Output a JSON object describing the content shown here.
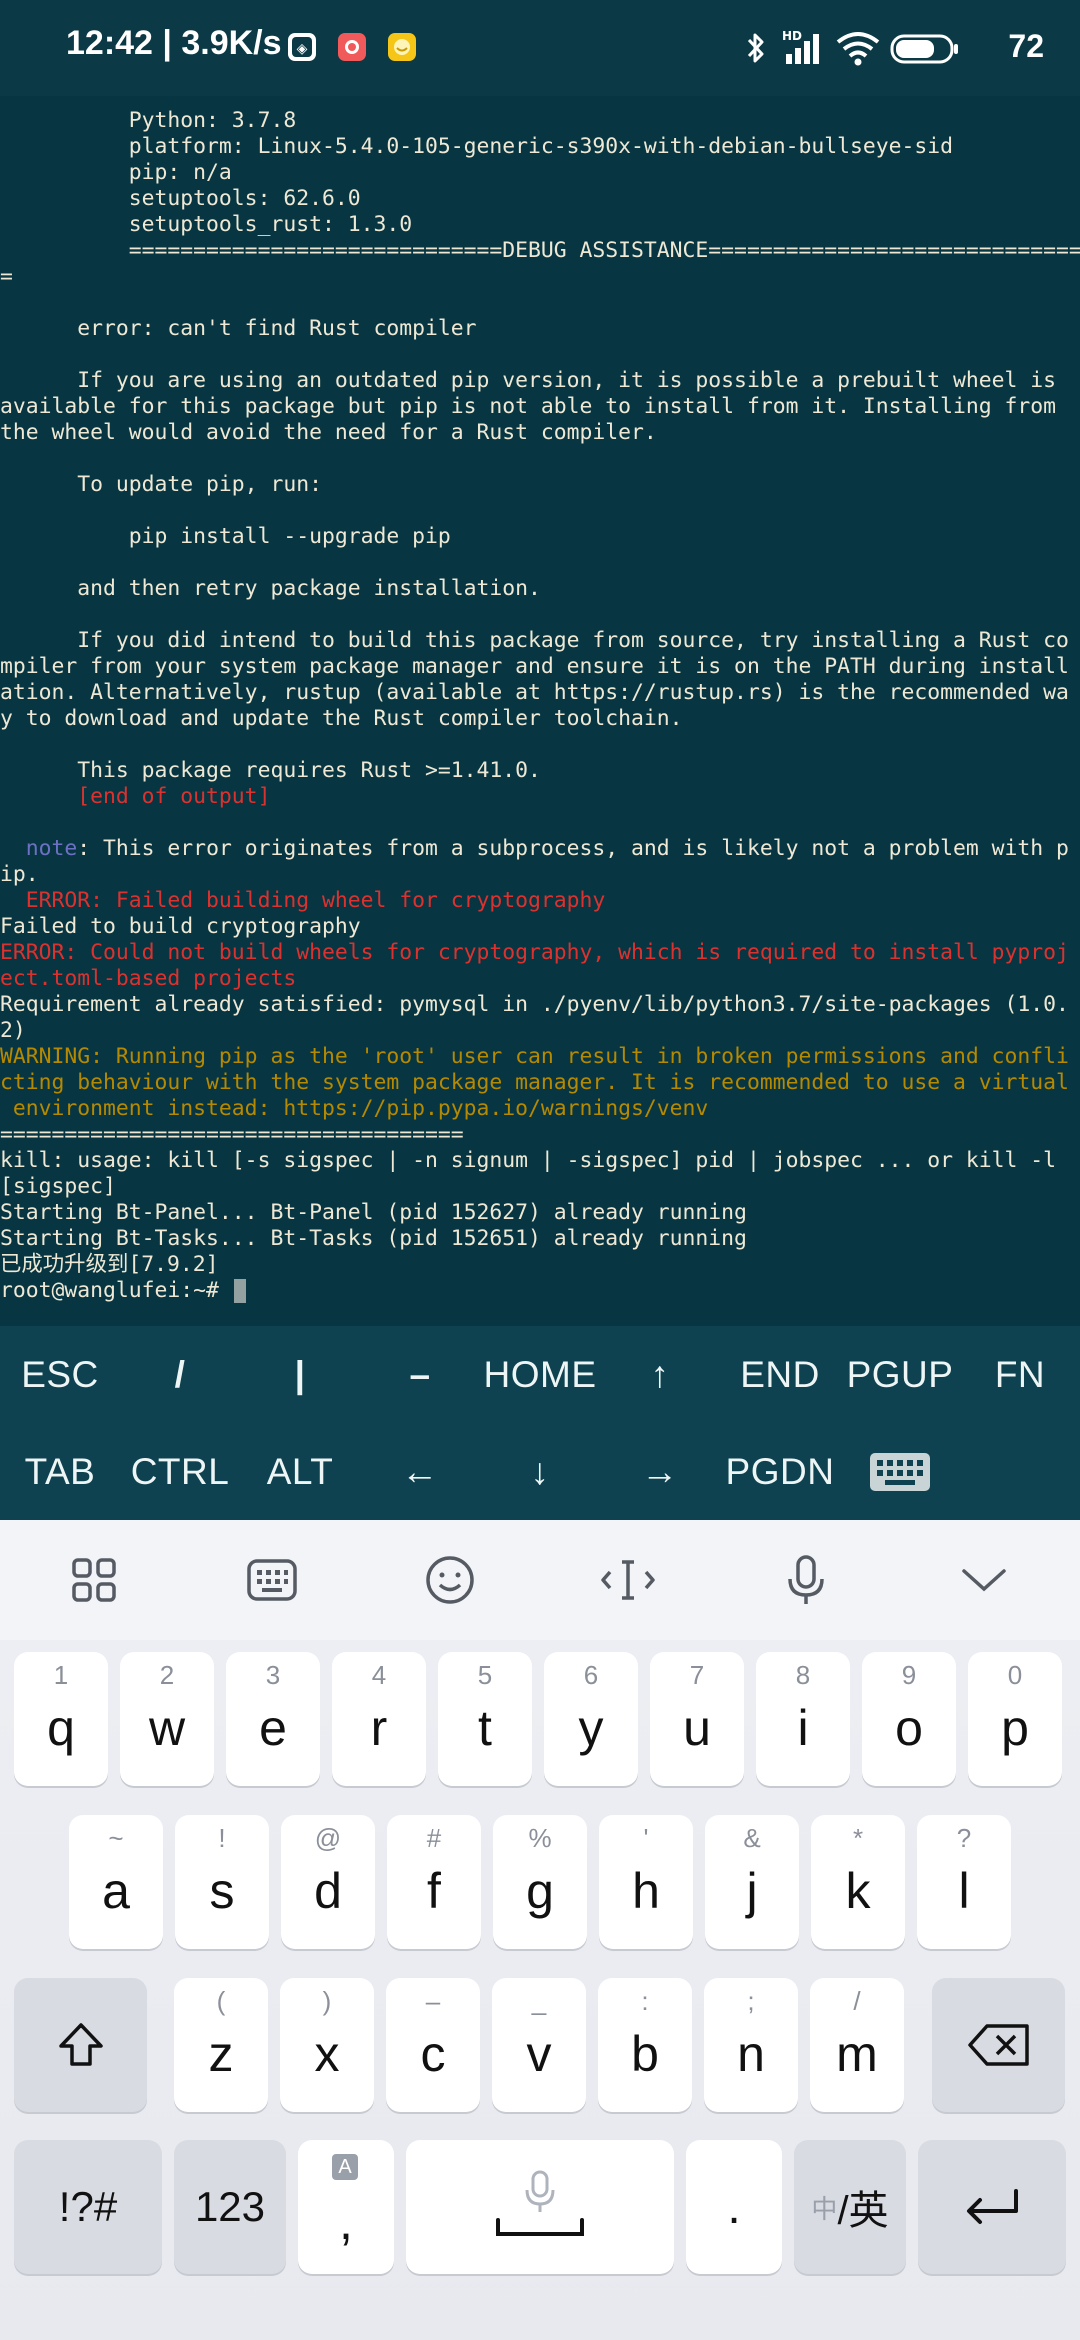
{
  "status_bar": {
    "time_speed": "12:42 | 3.9K/s",
    "battery": "72",
    "icons": [
      "bluetooth-icon",
      "hd-signal-icon",
      "wifi-icon",
      "battery-icon"
    ]
  },
  "terminal": {
    "lines": [
      {
        "text": "          Python: 3.7.8",
        "style": ""
      },
      {
        "text": "          platform: Linux-5.4.0-105-generic-s390x-with-debian-bullseye-sid",
        "style": ""
      },
      {
        "text": "          pip: n/a",
        "style": ""
      },
      {
        "text": "          setuptools: 62.6.0",
        "style": ""
      },
      {
        "text": "          setuptools_rust: 1.3.0",
        "style": ""
      },
      {
        "text": "          =============================DEBUG ASSISTANCE=============================",
        "style": ""
      },
      {
        "text": "=",
        "style": ""
      },
      {
        "text": "",
        "style": ""
      },
      {
        "text": "      error: can't find Rust compiler",
        "style": ""
      },
      {
        "text": "",
        "style": ""
      },
      {
        "text": "      If you are using an outdated pip version, it is possible a prebuilt wheel is",
        "style": ""
      },
      {
        "text": "available for this package but pip is not able to install from it. Installing from",
        "style": ""
      },
      {
        "text": "the wheel would avoid the need for a Rust compiler.",
        "style": ""
      },
      {
        "text": "",
        "style": ""
      },
      {
        "text": "      To update pip, run:",
        "style": ""
      },
      {
        "text": "",
        "style": ""
      },
      {
        "text": "          pip install --upgrade pip",
        "style": ""
      },
      {
        "text": "",
        "style": ""
      },
      {
        "text": "      and then retry package installation.",
        "style": ""
      },
      {
        "text": "",
        "style": ""
      },
      {
        "text": "      If you did intend to build this package from source, try installing a Rust co",
        "style": ""
      },
      {
        "text": "mpiler from your system package manager and ensure it is on the PATH during install",
        "style": ""
      },
      {
        "text": "ation. Alternatively, rustup (available at https://rustup.rs) is the recommended wa",
        "style": ""
      },
      {
        "text": "y to download and update the Rust compiler toolchain.",
        "style": ""
      },
      {
        "text": "",
        "style": ""
      },
      {
        "text": "      This package requires Rust >=1.41.0.",
        "style": ""
      },
      {
        "text": "      [end of output]",
        "style": "red"
      },
      {
        "text": "",
        "style": ""
      },
      {
        "text": "  note: This error originates from a subprocess, and is likely not a problem with p",
        "style": "note"
      },
      {
        "text": "ip.",
        "style": ""
      },
      {
        "text": "  ERROR: Failed building wheel for cryptography",
        "style": "red"
      },
      {
        "text": "Failed to build cryptography",
        "style": ""
      },
      {
        "text": "ERROR: Could not build wheels for cryptography, which is required to install pyproj",
        "style": "red"
      },
      {
        "text": "ect.toml-based projects",
        "style": "red"
      },
      {
        "text": "Requirement already satisfied: pymysql in ./pyenv/lib/python3.7/site-packages (1.0.",
        "style": ""
      },
      {
        "text": "2)",
        "style": ""
      },
      {
        "text": "WARNING: Running pip as the 'root' user can result in broken permissions and confli",
        "style": "yellow"
      },
      {
        "text": "cting behaviour with the system package manager. It is recommended to use a virtual",
        "style": "yellow"
      },
      {
        "text": " environment instead: https://pip.pypa.io/warnings/venv",
        "style": "yellow"
      },
      {
        "text": "====================================",
        "style": ""
      },
      {
        "text": "kill: usage: kill [-s sigspec | -n signum | -sigspec] pid | jobspec ... or kill -l",
        "style": ""
      },
      {
        "text": "[sigspec]",
        "style": ""
      },
      {
        "text": "Starting Bt-Panel... Bt-Panel (pid 152627) already running",
        "style": ""
      },
      {
        "text": "Starting Bt-Tasks... Bt-Tasks (pid 152651) already running",
        "style": ""
      },
      {
        "text": "已成功升级到[7.9.2]",
        "style": ""
      },
      {
        "text": "root@wanglufei:~# ",
        "style": ""
      }
    ],
    "note_word": "note"
  },
  "extra_keys": {
    "row1": [
      "ESC",
      "/",
      "|",
      "–",
      "HOME",
      "↑",
      "END",
      "PGUP",
      "FN"
    ],
    "row2": [
      "TAB",
      "CTRL",
      "ALT",
      "←",
      "↓",
      "→",
      "PGDN",
      "keyboard-toggle-icon"
    ]
  },
  "ime_toolbar": {
    "tools": [
      "apps-grid-icon",
      "keyboard-layout-icon",
      "emoji-icon",
      "cursor-move-icon",
      "microphone-icon",
      "collapse-chevron-icon"
    ]
  },
  "keyboard": {
    "row1": [
      {
        "main": "q",
        "hint": "1"
      },
      {
        "main": "w",
        "hint": "2"
      },
      {
        "main": "e",
        "hint": "3"
      },
      {
        "main": "r",
        "hint": "4"
      },
      {
        "main": "t",
        "hint": "5"
      },
      {
        "main": "y",
        "hint": "6"
      },
      {
        "main": "u",
        "hint": "7"
      },
      {
        "main": "i",
        "hint": "8"
      },
      {
        "main": "o",
        "hint": "9"
      },
      {
        "main": "p",
        "hint": "0"
      }
    ],
    "row2": [
      {
        "main": "a",
        "hint": "~"
      },
      {
        "main": "s",
        "hint": "!"
      },
      {
        "main": "d",
        "hint": "@"
      },
      {
        "main": "f",
        "hint": "#"
      },
      {
        "main": "g",
        "hint": "%"
      },
      {
        "main": "h",
        "hint": "'"
      },
      {
        "main": "j",
        "hint": "&"
      },
      {
        "main": "k",
        "hint": "*"
      },
      {
        "main": "l",
        "hint": "?"
      }
    ],
    "row3": [
      {
        "main": "z",
        "hint": "("
      },
      {
        "main": "x",
        "hint": ")"
      },
      {
        "main": "c",
        "hint": "–"
      },
      {
        "main": "v",
        "hint": "_"
      },
      {
        "main": "b",
        "hint": ":"
      },
      {
        "main": "n",
        "hint": ";"
      },
      {
        "main": "m",
        "hint": "/"
      }
    ],
    "symbols_label": "!?#",
    "numbers_label": "123",
    "comma_label": ",",
    "comma_badge": "A",
    "period_label": ".",
    "lang_toggle_cn": "中",
    "lang_toggle_en": "/英"
  }
}
